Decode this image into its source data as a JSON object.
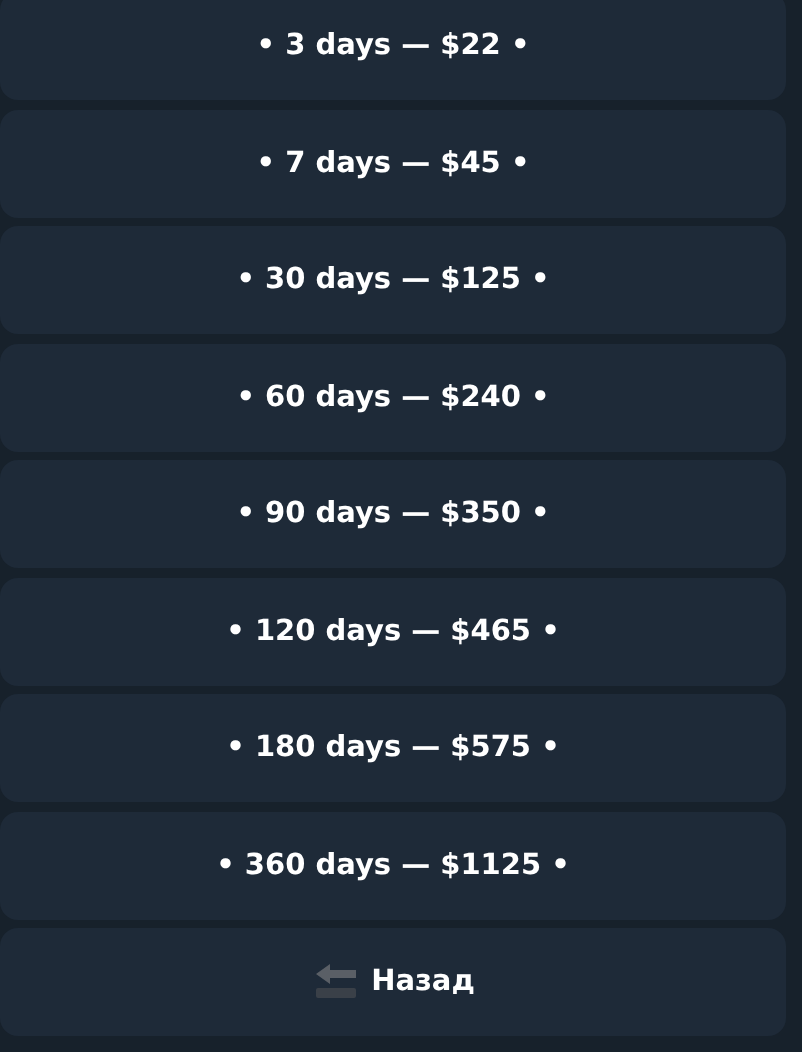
{
  "buttons": [
    {
      "kind": "option",
      "label": "• 3 days — $22 •"
    },
    {
      "kind": "option",
      "label": "• 7 days — $45 •"
    },
    {
      "kind": "option",
      "label": "• 30 days — $125 •"
    },
    {
      "kind": "option",
      "label": "• 60 days — $240 •"
    },
    {
      "kind": "option",
      "label": "• 90 days — $350 •"
    },
    {
      "kind": "option",
      "label": "• 120 days — $465 •"
    },
    {
      "kind": "option",
      "label": "• 180 days — $575 •"
    },
    {
      "kind": "option",
      "label": "• 360 days — $1125 •"
    },
    {
      "kind": "back",
      "label": "Назад"
    }
  ]
}
